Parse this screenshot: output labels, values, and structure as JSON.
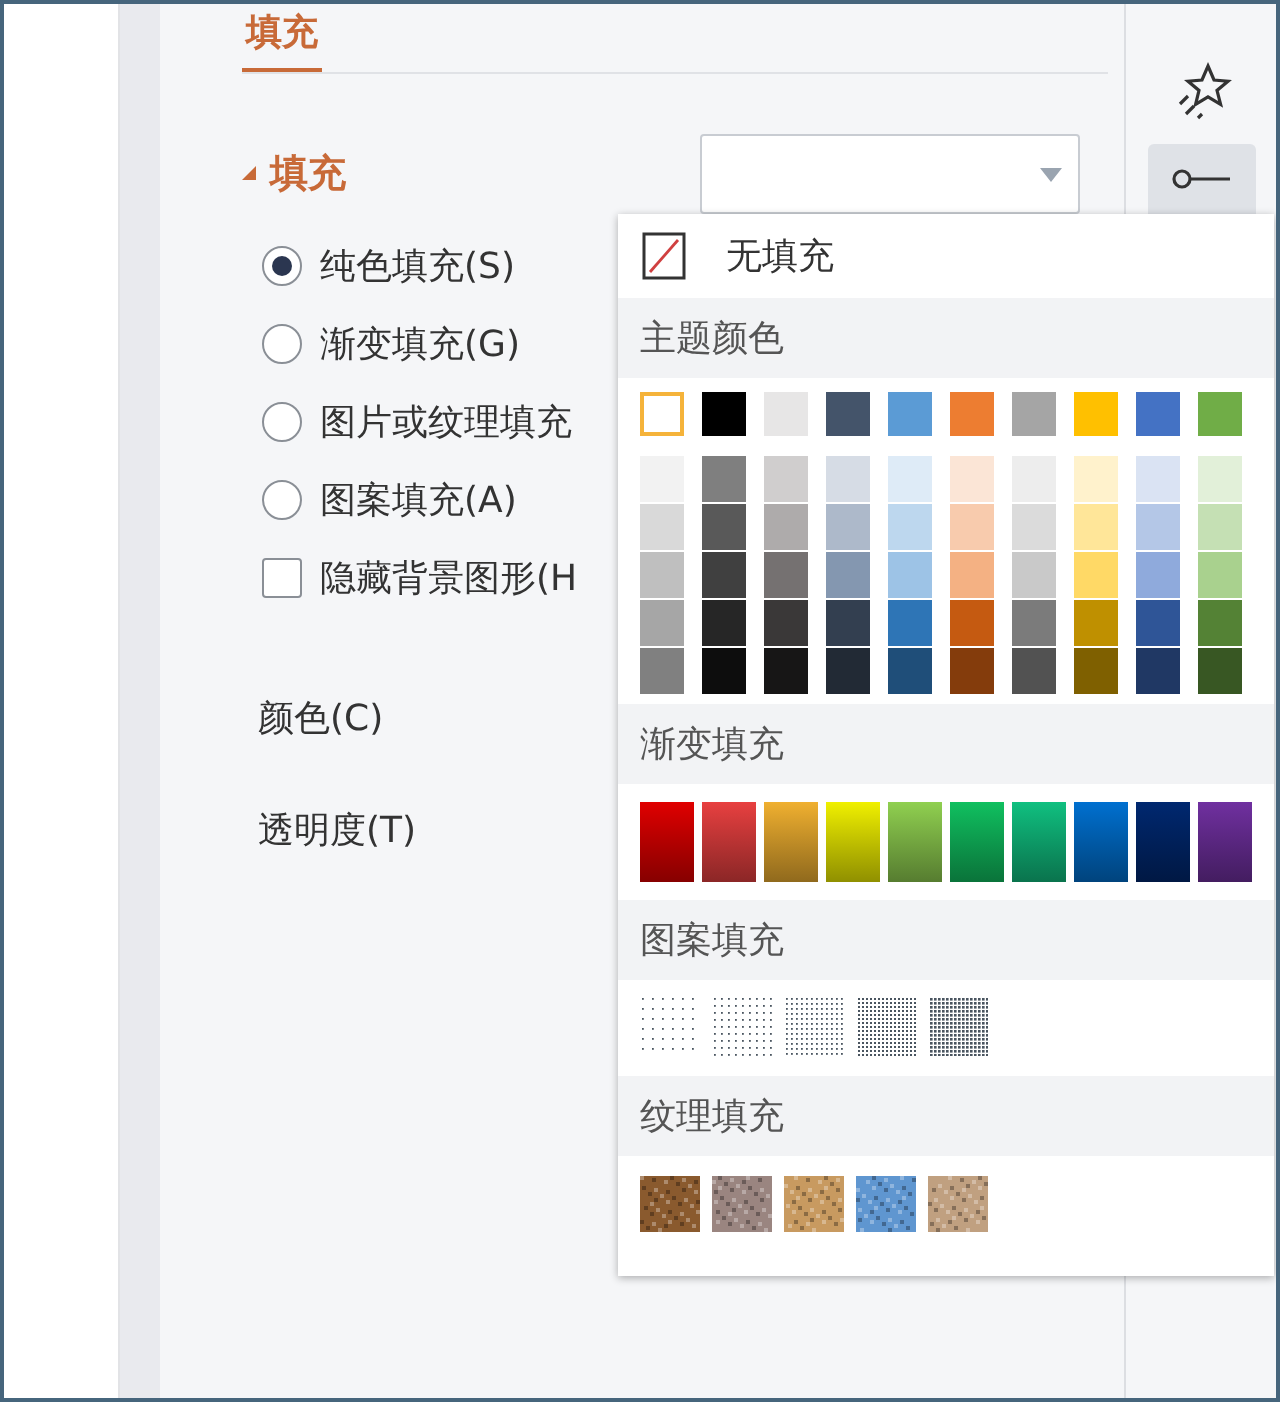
{
  "panel": {
    "tab": {
      "label": "填充",
      "selected": true
    },
    "section": {
      "title": "填充",
      "expanded": true
    },
    "fill_options": [
      {
        "kind": "radio",
        "label": "纯色填充(S)",
        "selected": true
      },
      {
        "kind": "radio",
        "label": "渐变填充(G)",
        "selected": false
      },
      {
        "kind": "radio",
        "label": "图片或纹理填充",
        "selected": false
      },
      {
        "kind": "radio",
        "label": "图案填充(A)",
        "selected": false
      },
      {
        "kind": "checkbox",
        "label": "隐藏背景图形(H",
        "checked": false
      }
    ],
    "color_label": "颜色(C)",
    "transparency_label": "透明度(T)"
  },
  "color_popup": {
    "no_fill": "无填充",
    "theme_title": "主题颜色",
    "theme_colors": [
      {
        "color": "#ffffff",
        "selected": true,
        "shades": [
          {
            "color": "#f2f2f2"
          },
          {
            "color": "#d9d9d9"
          },
          {
            "color": "#bfbfbf"
          },
          {
            "color": "#a6a6a6"
          },
          {
            "color": "#808080"
          }
        ]
      },
      {
        "color": "#000000",
        "selected": false,
        "shades": [
          {
            "color": "#7f7f7f"
          },
          {
            "color": "#595959"
          },
          {
            "color": "#404040"
          },
          {
            "color": "#262626"
          },
          {
            "color": "#0d0d0d"
          }
        ]
      },
      {
        "color": "#e7e6e6",
        "selected": false,
        "shades": [
          {
            "color": "#d0cece"
          },
          {
            "color": "#aeabab"
          },
          {
            "color": "#757171"
          },
          {
            "color": "#3a3838"
          },
          {
            "color": "#171616"
          }
        ]
      },
      {
        "color": "#44546a",
        "selected": false,
        "shades": [
          {
            "color": "#d6dce5"
          },
          {
            "color": "#adb9ca"
          },
          {
            "color": "#8497b0"
          },
          {
            "color": "#333f50"
          },
          {
            "color": "#222a35"
          }
        ]
      },
      {
        "color": "#5b9bd5",
        "selected": false,
        "shades": [
          {
            "color": "#deebf7"
          },
          {
            "color": "#bdd7ee"
          },
          {
            "color": "#9dc3e6"
          },
          {
            "color": "#2e75b6"
          },
          {
            "color": "#1f4e79"
          }
        ]
      },
      {
        "color": "#ed7d31",
        "selected": false,
        "shades": [
          {
            "color": "#fbe5d6"
          },
          {
            "color": "#f8cbad"
          },
          {
            "color": "#f4b183"
          },
          {
            "color": "#c55a11"
          },
          {
            "color": "#843c0c"
          }
        ]
      },
      {
        "color": "#a5a5a5",
        "selected": false,
        "shades": [
          {
            "color": "#ededed"
          },
          {
            "color": "#dbdbdb"
          },
          {
            "color": "#c9c9c9"
          },
          {
            "color": "#7b7b7b"
          },
          {
            "color": "#525252"
          }
        ]
      },
      {
        "color": "#ffc000",
        "selected": false,
        "shades": [
          {
            "color": "#fff2cc"
          },
          {
            "color": "#ffe699"
          },
          {
            "color": "#ffd966"
          },
          {
            "color": "#bf9000"
          },
          {
            "color": "#7f6000"
          }
        ]
      },
      {
        "color": "#4472c4",
        "selected": false,
        "shades": [
          {
            "color": "#dae3f3"
          },
          {
            "color": "#b4c7e7"
          },
          {
            "color": "#8faadc"
          },
          {
            "color": "#2f5597"
          },
          {
            "color": "#203864"
          }
        ]
      },
      {
        "color": "#70ad47",
        "selected": false,
        "shades": [
          {
            "color": "#e2f0d9"
          },
          {
            "color": "#c5e0b4"
          },
          {
            "color": "#a9d18e"
          },
          {
            "color": "#548235"
          },
          {
            "color": "#385723"
          }
        ]
      }
    ],
    "gradient_title": "渐变填充",
    "gradients": [
      {
        "color": "#e00000"
      },
      {
        "color": "#e84040"
      },
      {
        "color": "#f0b030"
      },
      {
        "color": "#f0f000"
      },
      {
        "color": "#90d050"
      },
      {
        "color": "#10c060"
      },
      {
        "color": "#10c080"
      },
      {
        "color": "#0070d0"
      },
      {
        "color": "#002870"
      },
      {
        "color": "#7030a0"
      }
    ],
    "pattern_title": "图案填充",
    "patterns": [
      {
        "kind": "sparse"
      },
      {
        "kind": "light"
      },
      {
        "kind": "medium"
      },
      {
        "kind": "dense"
      },
      {
        "kind": "grid"
      }
    ],
    "texture_title": "纹理填充",
    "textures": [
      {
        "color": "#8a5a2e"
      },
      {
        "color": "#9a8580"
      },
      {
        "color": "#c89a60"
      },
      {
        "color": "#5f96d0"
      },
      {
        "color": "#c0a080"
      }
    ]
  }
}
